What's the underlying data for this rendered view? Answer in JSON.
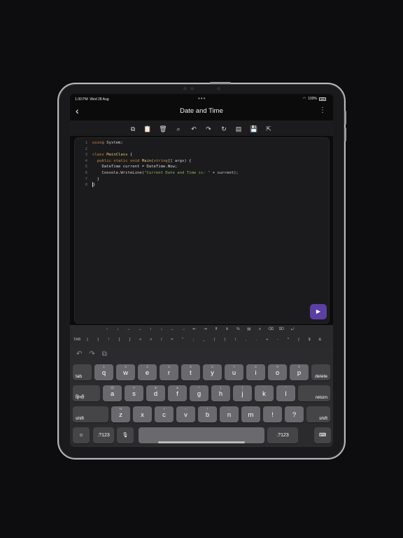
{
  "status_bar": {
    "time": "1:30 PM",
    "date": "Wed 28 Aug",
    "battery": "100%",
    "multitask_dots": "•••"
  },
  "nav": {
    "title": "Date and Time",
    "back_icon": "chevron-left-icon",
    "more_icon": "more-vertical-icon"
  },
  "toolbar": {
    "icons": [
      "copy-icon",
      "paste-icon",
      "delete-icon",
      "find-icon",
      "undo-icon",
      "redo-icon",
      "refresh-icon",
      "format-icon",
      "save-icon",
      "share-icon"
    ]
  },
  "editor": {
    "line_numbers": [
      "1",
      "2",
      "3",
      "4",
      "5",
      "6",
      "7",
      "8"
    ],
    "lines": [
      [
        {
          "t": "using",
          "c": "kw"
        },
        {
          "t": " System;",
          "c": "tx"
        }
      ],
      [],
      [
        {
          "t": "class ",
          "c": "kw"
        },
        {
          "t": "MainClass",
          "c": "cls"
        },
        {
          "t": " {",
          "c": "tx"
        }
      ],
      [
        {
          "t": "  public static void ",
          "c": "kw"
        },
        {
          "t": "Main",
          "c": "cls"
        },
        {
          "t": "(",
          "c": "tx"
        },
        {
          "t": "string",
          "c": "kw"
        },
        {
          "t": "[] args) {",
          "c": "tx"
        }
      ],
      [
        {
          "t": "    DateTime current = DateTime.Now;",
          "c": "tx"
        }
      ],
      [
        {
          "t": "    Console.WriteLine(",
          "c": "tx"
        },
        {
          "t": "\"Current Date and Time is: \"",
          "c": "str"
        },
        {
          "t": " + current);",
          "c": "tx"
        }
      ],
      [
        {
          "t": "  }",
          "c": "tx"
        }
      ],
      [
        {
          "t": "}",
          "c": "tx"
        }
      ]
    ]
  },
  "run_button": {
    "icon": "play-icon",
    "glyph": "▶"
  },
  "symbol_bar": {
    "row1": [
      "↑",
      "↓",
      "←",
      "→",
      "↑",
      "↓",
      "←",
      "→",
      "⇤",
      "⇥",
      "⇞",
      "⇟",
      "%",
      "▤",
      "≡",
      "⌫",
      "⌦",
      "⤾"
    ],
    "row2": [
      "TAB",
      "{",
      "}",
      "!",
      "[",
      "]",
      "<",
      ">",
      "/",
      "=",
      "\"",
      ";",
      "_",
      "|",
      "|",
      "\\",
      ",",
      ".",
      "+",
      "-",
      "*",
      "(",
      "$",
      "&"
    ]
  },
  "keyboard": {
    "tools": [
      "undo-icon",
      "redo-icon",
      "clipboard-icon"
    ],
    "row1": [
      {
        "k": "q",
        "s": "1"
      },
      {
        "k": "w",
        "s": "2"
      },
      {
        "k": "e",
        "s": "3"
      },
      {
        "k": "r",
        "s": "4"
      },
      {
        "k": "t",
        "s": "5"
      },
      {
        "k": "y",
        "s": "6"
      },
      {
        "k": "u",
        "s": "7"
      },
      {
        "k": "i",
        "s": "8"
      },
      {
        "k": "o",
        "s": "9"
      },
      {
        "k": "p",
        "s": "0"
      }
    ],
    "row2": [
      {
        "k": "a",
        "s": "@"
      },
      {
        "k": "s",
        "s": "#"
      },
      {
        "k": "d",
        "s": "$"
      },
      {
        "k": "f",
        "s": "&"
      },
      {
        "k": "g",
        "s": "*"
      },
      {
        "k": "h",
        "s": "("
      },
      {
        "k": "j",
        "s": ")"
      },
      {
        "k": "k",
        "s": "'"
      },
      {
        "k": "l",
        "s": "\""
      }
    ],
    "row3": [
      {
        "k": "z",
        "s": "%"
      },
      {
        "k": "x",
        "s": "-"
      },
      {
        "k": "c",
        "s": "+"
      },
      {
        "k": "v",
        "s": "="
      },
      {
        "k": "b",
        "s": "/"
      },
      {
        "k": "n",
        "s": ";"
      },
      {
        "k": "m",
        "s": ":"
      },
      {
        "k": "!",
        "s": ","
      },
      {
        "k": "?",
        "s": "."
      }
    ],
    "tab": "tab",
    "delete": "delete",
    "lang": "हिन्दी",
    "return": "return",
    "shift": "shift",
    "emoji": "☺",
    "numbers": ".?123",
    "mic": "🎙",
    "hide": "⌨"
  }
}
